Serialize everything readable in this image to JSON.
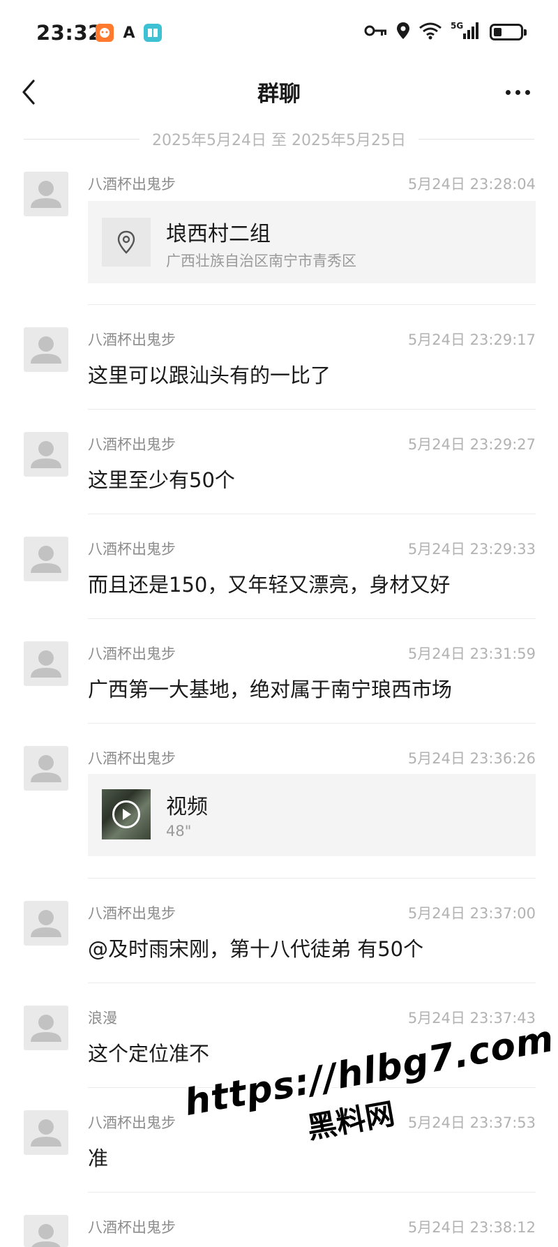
{
  "status_bar": {
    "time": "23:32",
    "app_icons": [
      "taobao-icon",
      "font-a-icon",
      "book-icon"
    ],
    "system_icons": [
      "key-icon",
      "location-icon",
      "wifi-icon",
      "signal-5g-icon",
      "battery-icon"
    ],
    "network": "5G",
    "battery_level": 0.3
  },
  "nav": {
    "title": "群聊",
    "back_icon": "chevron-left-icon",
    "more_icon": "more-dots-icon"
  },
  "date_range": "2025年5月24日 至 2025年5月25日",
  "messages": [
    {
      "sender": "八酒杯出鬼步",
      "time": "5月24日 23:28:04",
      "type": "location",
      "title": "埌西村二组",
      "subtitle": "广西壮族自治区南宁市青秀区"
    },
    {
      "sender": "八酒杯出鬼步",
      "time": "5月24日 23:29:17",
      "type": "text",
      "text": "这里可以跟汕头有的一比了"
    },
    {
      "sender": "八酒杯出鬼步",
      "time": "5月24日 23:29:27",
      "type": "text",
      "text": "这里至少有50个"
    },
    {
      "sender": "八酒杯出鬼步",
      "time": "5月24日 23:29:33",
      "type": "text",
      "text": "而且还是150，又年轻又漂亮，身材又好"
    },
    {
      "sender": "八酒杯出鬼步",
      "time": "5月24日 23:31:59",
      "type": "text",
      "text": "广西第一大基地，绝对属于南宁琅西市场"
    },
    {
      "sender": "八酒杯出鬼步",
      "time": "5月24日 23:36:26",
      "type": "video",
      "title": "视频",
      "duration": "48\""
    },
    {
      "sender": "八酒杯出鬼步",
      "time": "5月24日 23:37:00",
      "type": "text",
      "text": "@及时雨宋刚，第十八代徒弟 有50个"
    },
    {
      "sender": "浪漫",
      "time": "5月24日 23:37:43",
      "type": "text",
      "text": "这个定位准不"
    },
    {
      "sender": "八酒杯出鬼步",
      "time": "5月24日 23:37:53",
      "type": "text",
      "text": "准"
    },
    {
      "sender": "八酒杯出鬼步",
      "time": "5月24日 23:38:12",
      "type": "text",
      "text": ""
    }
  ],
  "watermark": {
    "url": "https://hlbg7.com",
    "name": "黑料网"
  }
}
